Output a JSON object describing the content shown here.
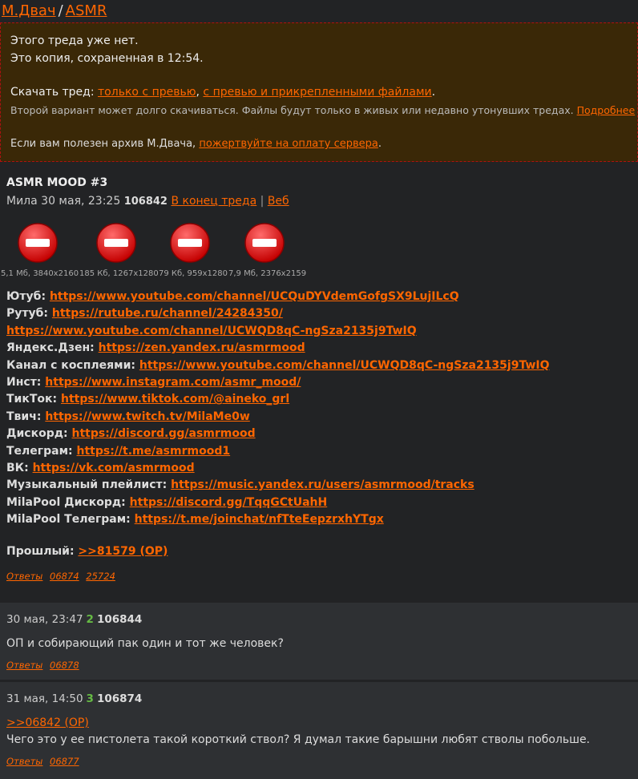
{
  "breadcrumb": {
    "home": "М.Двач",
    "separator": "/",
    "board": "ASMR"
  },
  "notice": {
    "line1": "Этого треда уже нет.",
    "line2": "Это копия, сохраненная в 12:54.",
    "download_label": "Скачать тред:",
    "download_previews": "только с превью",
    "download_comma": ",",
    "download_full": "с превью и прикрепленными файлами",
    "download_end": ".",
    "warning": "Второй вариант может долго скачиваться. Файлы будут только в живых или недавно утонувших тредах.",
    "more_link": "Подробнее",
    "donate_text": "Если вам полезен архив М.Двача,",
    "donate_link": "пожертвуйте на оплату сервера",
    "donate_end": "."
  },
  "op": {
    "title": "ASMR MOOD #3",
    "author": "Мила",
    "date": "30 мая, 23:25",
    "number": "106842",
    "to_end_link": "В конец треда",
    "sep": "|",
    "web_link": "Веб",
    "files": [
      {
        "size": "5,1 Мб, 3840x2160"
      },
      {
        "size": "185 Кб, 1267x1280"
      },
      {
        "size": "79 Кб, 959x1280"
      },
      {
        "size": "7,9 Мб, 2376x2159"
      }
    ],
    "links": [
      {
        "label": "Ютуб:",
        "url": "https://www.youtube.com/channel/UCQuDYVdemGofgSX9LujILcQ"
      },
      {
        "label": "Рутуб:",
        "url": "https://rutube.ru/channel/24284350/"
      },
      {
        "label": "",
        "url": "https://www.youtube.com/channel/UCWQD8qC-ngSza2135j9TwIQ"
      },
      {
        "label": "Яндекс.Дзен:",
        "url": "https://zen.yandex.ru/asmrmood"
      },
      {
        "label": "Канал с косплеями:",
        "url": "https://www.youtube.com/channel/UCWQD8qC-ngSza2135j9TwIQ"
      },
      {
        "label": "Инст:",
        "url": "https://www.instagram.com/asmr_mood/"
      },
      {
        "label": "ТикТок:",
        "url": "https://www.tiktok.com/@aineko_grl"
      },
      {
        "label": "Твич:",
        "url": "https://www.twitch.tv/MilaMe0w"
      },
      {
        "label": "Дискорд:",
        "url": "https://discord.gg/asmrmood"
      },
      {
        "label": "Телеграм:",
        "url": "https://t.me/asmrmood1"
      },
      {
        "label": "ВК:",
        "url": "https://vk.com/asmrmood"
      },
      {
        "label": "Музыкальный плейлист:",
        "url": "https://music.yandex.ru/users/asmrmood/tracks"
      },
      {
        "label": "MilaPool Дискорд:",
        "url": "https://discord.gg/TqqGCtUahH"
      },
      {
        "label": "MilaPool Телеграм:",
        "url": "https://t.me/joinchat/nfTteEepzrxhYTgx"
      }
    ],
    "prev_label": "Прошлый:",
    "prev_link": ">>81579 (OP)",
    "replies_label": "Ответы",
    "replies": [
      "06874",
      "25724"
    ]
  },
  "posts": [
    {
      "date": "30 мая, 23:47",
      "count": "2",
      "number": "106844",
      "quote": "",
      "text": "ОП и собирающий пак один и тот же человек?",
      "replies_label": "Ответы",
      "replies": [
        "06878"
      ]
    },
    {
      "date": "31 мая, 14:50",
      "count": "3",
      "number": "106874",
      "quote": ">>06842 (OP)",
      "text": "Чего это у ее пистолета такой короткий ствол? Я думал такие барышни любят стволы побольше.",
      "replies_label": "Ответы",
      "replies": [
        "06877"
      ]
    }
  ]
}
